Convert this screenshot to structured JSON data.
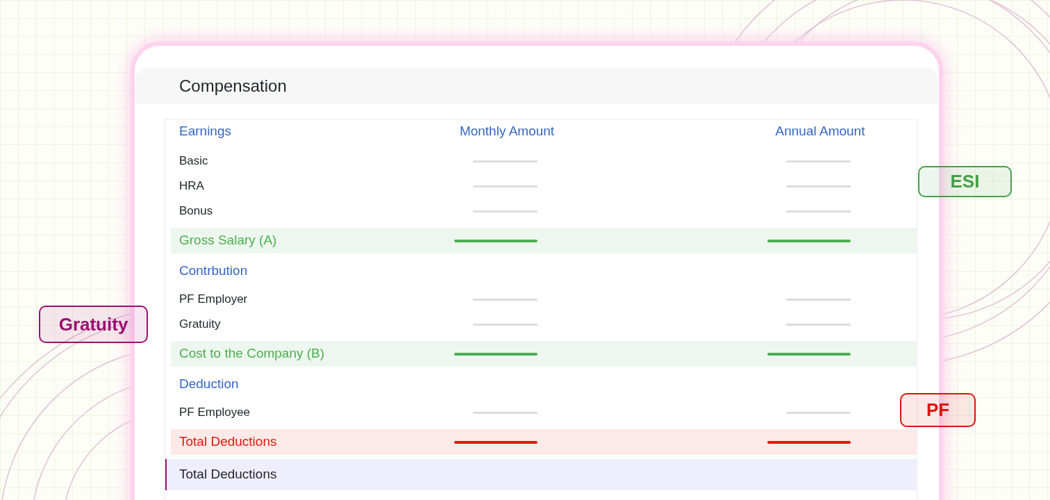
{
  "card": {
    "title": "Compensation"
  },
  "table": {
    "columns": [
      "Earnings",
      "Monthly Amount",
      "Annual Amount"
    ],
    "rows": [
      {
        "kind": "item",
        "label": "Basic"
      },
      {
        "kind": "item",
        "label": "HRA"
      },
      {
        "kind": "item",
        "label": "Bonus"
      },
      {
        "kind": "total",
        "label": "Gross Salary (A)",
        "color": "#4caf50"
      },
      {
        "kind": "section",
        "label": "Contrbution"
      },
      {
        "kind": "item",
        "label": "PF Employer"
      },
      {
        "kind": "item",
        "label": "Gratuity"
      },
      {
        "kind": "total",
        "label": "Cost to the Company (B)",
        "color": "#4caf50"
      },
      {
        "kind": "section",
        "label": "Deduction"
      },
      {
        "kind": "item",
        "label": "PF Employee"
      },
      {
        "kind": "total",
        "label": "Total Deductions",
        "color": "#e0190c"
      },
      {
        "kind": "final",
        "label": "Total Deductions"
      }
    ]
  },
  "tags": [
    {
      "label": "Gratuity",
      "color": "#9b0f72"
    },
    {
      "label": "ESI",
      "color": "#43a047"
    },
    {
      "label": "PF",
      "color": "#d9150b"
    }
  ]
}
